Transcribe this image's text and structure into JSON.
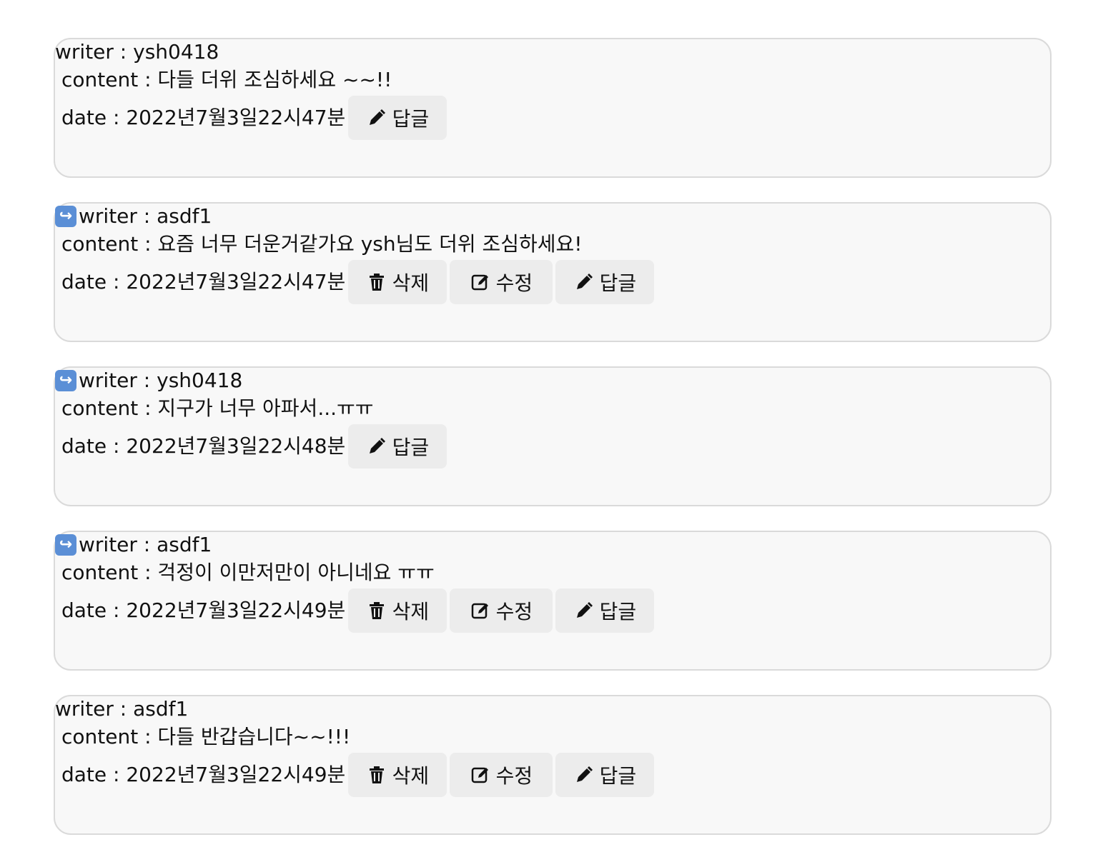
{
  "comments": [
    {
      "is_reply": false,
      "writer": "writer : ysh0418",
      "content": "content : 다들 더위 조심하세요 ~~!!",
      "date": "date : 2022년7월3일22시47분",
      "buttons": [
        {
          "icon": "pencil-icon",
          "label": "답글"
        }
      ]
    },
    {
      "is_reply": true,
      "writer": "writer : asdf1",
      "content": "content : 요즘 너무 더운거같가요 ysh님도 더위 조심하세요!",
      "date": "date : 2022년7월3일22시47분",
      "buttons": [
        {
          "icon": "trash-icon",
          "label": "삭제"
        },
        {
          "icon": "edit-icon",
          "label": "수정"
        },
        {
          "icon": "pencil-icon",
          "label": "답글"
        }
      ]
    },
    {
      "is_reply": true,
      "writer": "writer : ysh0418",
      "content": "content : 지구가 너무 아파서...ㅠㅠ",
      "date": "date : 2022년7월3일22시48분",
      "buttons": [
        {
          "icon": "pencil-icon",
          "label": "답글"
        }
      ]
    },
    {
      "is_reply": true,
      "writer": "writer : asdf1",
      "content": "content : 걱정이 이만저만이 아니네요 ㅠㅠ",
      "date": "date : 2022년7월3일22시49분",
      "buttons": [
        {
          "icon": "trash-icon",
          "label": "삭제"
        },
        {
          "icon": "edit-icon",
          "label": "수정"
        },
        {
          "icon": "pencil-icon",
          "label": "답글"
        }
      ]
    },
    {
      "is_reply": false,
      "writer": "writer : asdf1",
      "content": "content : 다들 반갑습니다~~!!!",
      "date": "date : 2022년7월3일22시49분",
      "buttons": [
        {
          "icon": "trash-icon",
          "label": "삭제"
        },
        {
          "icon": "edit-icon",
          "label": "수정"
        },
        {
          "icon": "pencil-icon",
          "label": "답글"
        }
      ]
    }
  ]
}
